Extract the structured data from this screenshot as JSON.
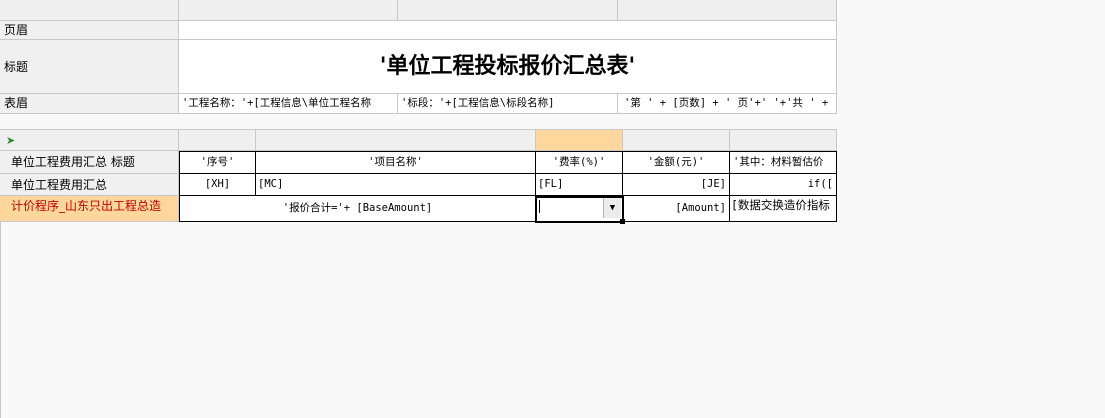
{
  "sections": {
    "header_label": "页眉",
    "title_label": "标题",
    "table_header_label": "表眉"
  },
  "report_title": "'单位工程投标报价汇总表'",
  "table_header_fields": {
    "project_name": "'工程名称：'+[工程信息\\单位工程名称",
    "bid_section": "'标段：'+[工程信息\\标段名称]",
    "page_info": "'第 ' + [页数] + ' 页'+' '+'共 ' +"
  },
  "detail": {
    "band_title_label": "单位工程费用汇总 标题",
    "band_data_label": "单位工程费用汇总",
    "band_footer_label": "计价程序_山东只出工程总造",
    "header_row": {
      "seq": "'序号'",
      "item_name": "'项目名称'",
      "rate": "'费率(%)'",
      "amount": "'金额(元)'",
      "material_estimate": "'其中：材料暂估价"
    },
    "data_row": {
      "seq": "[XH]",
      "item_name": "[MC]",
      "rate": "[FL]",
      "amount": "[JE]",
      "material_estimate": "if(["
    },
    "footer_row": {
      "total_label": "'报价合计='+ [BaseAmount]",
      "rate_value": "",
      "amount": "[Amount]",
      "index": "[数据交换造价指标"
    }
  },
  "icons": {
    "band_arrow": "arrow-right-icon",
    "dropdown": "chevron-down-icon"
  }
}
